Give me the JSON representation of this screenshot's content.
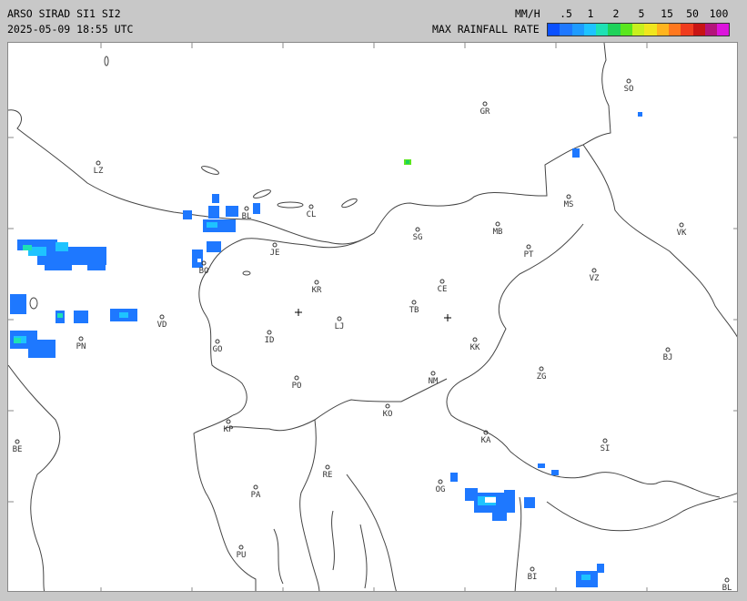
{
  "header": {
    "title": "ARSO SIRAD SI1 SI2",
    "timestamp": "2025-05-09 18:55 UTC",
    "units": "MM/H",
    "rate_label": "MAX RAINFALL RATE"
  },
  "scale": {
    "ticks": [
      ".5",
      "1",
      "2",
      "5",
      "15",
      "50",
      "100"
    ],
    "colors": [
      "#0a50ff",
      "#1e78ff",
      "#1e9bff",
      "#1ec3ff",
      "#1ee1b4",
      "#1ed25a",
      "#5ae61e",
      "#c8f01e",
      "#f0e61e",
      "#ffb41e",
      "#ff781e",
      "#f03c1e",
      "#c81414",
      "#b4147a",
      "#dc14dc"
    ]
  },
  "cities": [
    {
      "code": "GR"
    },
    {
      "code": "SO"
    },
    {
      "code": "LZ"
    },
    {
      "code": "CL"
    },
    {
      "code": "BL"
    },
    {
      "code": "MB"
    },
    {
      "code": "MS"
    },
    {
      "code": "VK"
    },
    {
      "code": "JE"
    },
    {
      "code": "SG"
    },
    {
      "code": "PT"
    },
    {
      "code": "KR"
    },
    {
      "code": "CE"
    },
    {
      "code": "VZ"
    },
    {
      "code": "BO"
    },
    {
      "code": "TB"
    },
    {
      "code": "LJ"
    },
    {
      "code": "VD"
    },
    {
      "code": "PN"
    },
    {
      "code": "ID"
    },
    {
      "code": "GO"
    },
    {
      "code": "KK"
    },
    {
      "code": "BJ"
    },
    {
      "code": "ZG"
    },
    {
      "code": "PO"
    },
    {
      "code": "NM"
    },
    {
      "code": "KO"
    },
    {
      "code": "KP"
    },
    {
      "code": "KA"
    },
    {
      "code": "SI"
    },
    {
      "code": "BE"
    },
    {
      "code": "RE"
    },
    {
      "code": "OG"
    },
    {
      "code": "PA"
    },
    {
      "code": "PU"
    },
    {
      "code": "BI"
    },
    {
      "code": "BL"
    }
  ]
}
